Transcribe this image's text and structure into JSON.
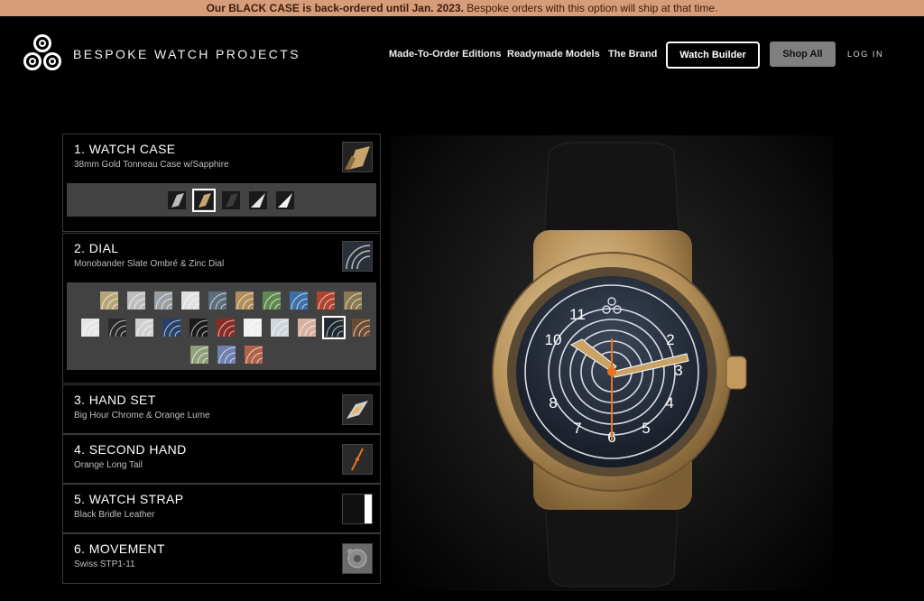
{
  "banner": {
    "bold_text": "Our BLACK CASE is back-ordered until Jan. 2023.",
    "text": " Bespoke orders with this option will ship at that time."
  },
  "header": {
    "brand": "BESPOKE WATCH PROJECTS",
    "nav": [
      "Made-To-Order Editions",
      "Readymade Models",
      "The Brand"
    ],
    "watch_builder": "Watch Builder",
    "shop_all": "Shop All",
    "login": "LOG IN"
  },
  "steps": [
    {
      "title": "1. WATCH CASE",
      "subtitle": "38mm Gold Tonneau Case w/Sapphire"
    },
    {
      "title": "2. DIAL",
      "subtitle": "Monobander Slate Ombré & Zinc Dial"
    },
    {
      "title": "3. HAND SET",
      "subtitle": "Big Hour Chrome & Orange Lume"
    },
    {
      "title": "4. SECOND HAND",
      "subtitle": "Orange Long Tail"
    },
    {
      "title": "5. WATCH STRAP",
      "subtitle": "Black Bridle Leather"
    },
    {
      "title": "6. MOVEMENT",
      "subtitle": "Swiss STP1-11"
    }
  ],
  "dial_numerals": [
    "2",
    "3",
    "4",
    "5",
    "6",
    "7",
    "8",
    "10",
    "11"
  ],
  "colors": {
    "banner_bg": "#d79d79",
    "case_gold": "#b8935c",
    "dial": "#1c2330",
    "lume_orange": "#e8731c",
    "tray": "#424242"
  }
}
